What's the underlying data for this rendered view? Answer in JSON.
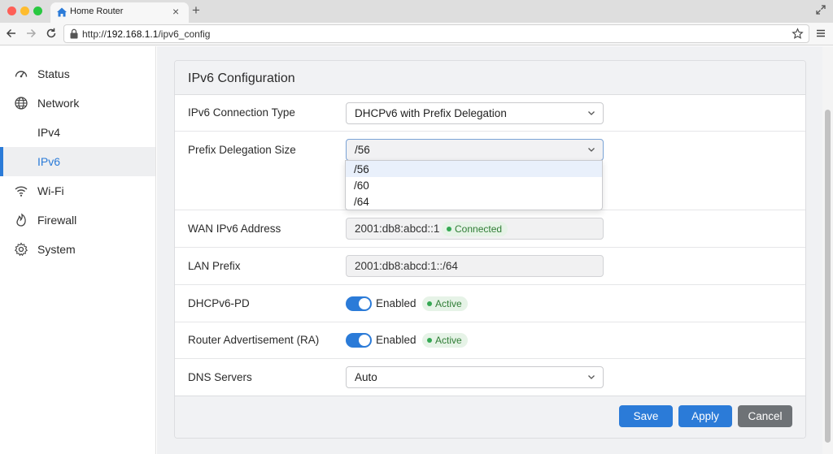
{
  "browser": {
    "tab_title": "Home Router",
    "url_prefix": "http://",
    "url_host": "192.168.1.1",
    "url_path": "/ipv6_config"
  },
  "sidebar": {
    "items": [
      {
        "label": "Status",
        "icon": "gauge-icon"
      },
      {
        "label": "Network",
        "icon": "globe-icon"
      },
      {
        "label": "IPv4",
        "icon": ""
      },
      {
        "label": "IPv6",
        "icon": "",
        "active": true
      },
      {
        "label": "Wi-Fi",
        "icon": "wifi-icon"
      },
      {
        "label": "Firewall",
        "icon": "flame-icon"
      },
      {
        "label": "System",
        "icon": "gear-icon"
      }
    ]
  },
  "card": {
    "title": "IPv6 Configuration",
    "rows": {
      "connection_type": {
        "label": "IPv6 Connection Type",
        "value": "DHCPv6 with Prefix Delegation"
      },
      "prefix_size": {
        "label": "Prefix Delegation Size",
        "value": "/56",
        "options": [
          "/56",
          "/60",
          "/64"
        ]
      },
      "wan_address": {
        "label": "WAN IPv6 Address",
        "value": "2001:db8:abcd::1",
        "badge": "Connected"
      },
      "lan_prefix": {
        "label": "LAN Prefix",
        "value": "2001:db8:abcd:1::/64"
      },
      "dhcpv6_pd": {
        "label": "DHCPv6-PD",
        "toggle_label": "Enabled",
        "badge": "Active",
        "enabled": true
      },
      "router_adv": {
        "label": "Router Advertisement (RA)",
        "toggle_label": "Enabled",
        "badge": "Active",
        "enabled": true
      },
      "dns": {
        "label": "DNS Servers",
        "value": "Auto"
      }
    },
    "buttons": {
      "save": "Save",
      "apply": "Apply",
      "cancel": "Cancel"
    }
  },
  "colors": {
    "accent": "#2b7bd8",
    "status_green": "#34a853",
    "cancel_gray": "#6e7276"
  }
}
